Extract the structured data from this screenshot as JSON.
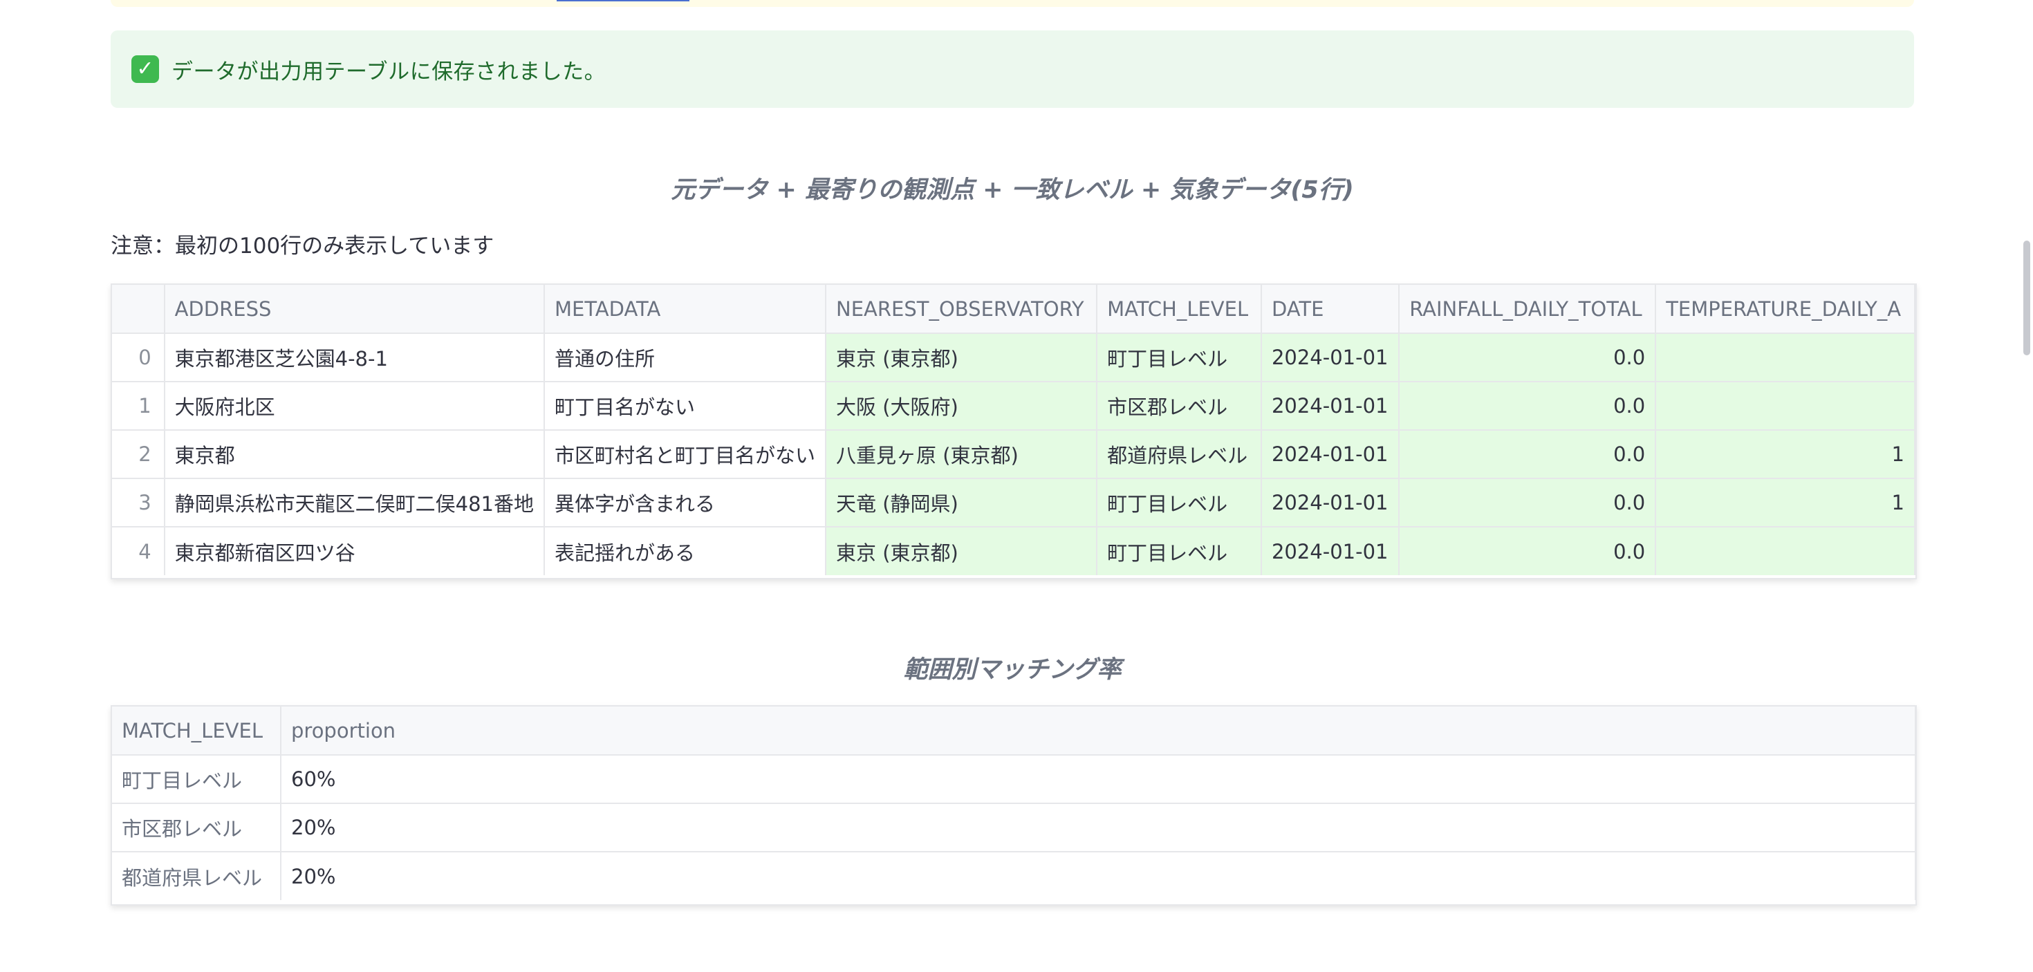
{
  "success": {
    "icon": "check-icon",
    "message": "データが出力用テーブルに保存されました。"
  },
  "main_table": {
    "title": "元データ + 最寄りの観測点 + 一致レベル + 気象データ(5行)",
    "note": "注意：最初の100行のみ表示しています",
    "columns": [
      "",
      "ADDRESS",
      "METADATA",
      "NEAREST_OBSERVATORY",
      "MATCH_LEVEL",
      "DATE",
      "RAINFALL_DAILY_TOTAL",
      "TEMPERATURE_DAILY_A"
    ],
    "rows": [
      {
        "index": "0",
        "address": "東京都港区芝公園4-8-1",
        "metadata": "普通の住所",
        "observatory": "東京 (東京都)",
        "match_level": "町丁目レベル",
        "date": "2024-01-01",
        "rainfall": "0.0",
        "temperature": ""
      },
      {
        "index": "1",
        "address": "大阪府北区",
        "metadata": "町丁目名がない",
        "observatory": "大阪 (大阪府)",
        "match_level": "市区郡レベル",
        "date": "2024-01-01",
        "rainfall": "0.0",
        "temperature": ""
      },
      {
        "index": "2",
        "address": "東京都",
        "metadata": "市区町村名と町丁目名がない",
        "observatory": "八重見ヶ原 (東京都)",
        "match_level": "都道府県レベル",
        "date": "2024-01-01",
        "rainfall": "0.0",
        "temperature": "1"
      },
      {
        "index": "3",
        "address": "静岡県浜松市天龍区二俣町二俣481番地",
        "metadata": "異体字が含まれる",
        "observatory": "天竜 (静岡県)",
        "match_level": "町丁目レベル",
        "date": "2024-01-01",
        "rainfall": "0.0",
        "temperature": "1"
      },
      {
        "index": "4",
        "address": "東京都新宿区四ツ谷",
        "metadata": "表記揺れがある",
        "observatory": "東京 (東京都)",
        "match_level": "町丁目レベル",
        "date": "2024-01-01",
        "rainfall": "0.0",
        "temperature": ""
      }
    ]
  },
  "rate_table": {
    "title": "範囲別マッチング率",
    "columns": [
      "MATCH_LEVEL",
      "proportion"
    ],
    "rows": [
      {
        "level": "町丁目レベル",
        "proportion": "60%"
      },
      {
        "level": "市区郡レベル",
        "proportion": "20%"
      },
      {
        "level": "都道府県レベル",
        "proportion": "20%"
      }
    ]
  },
  "colors": {
    "success_bg": "#ecf8ee",
    "success_text": "#1f6b2c",
    "highlight_cell": "#e4fbe3"
  }
}
